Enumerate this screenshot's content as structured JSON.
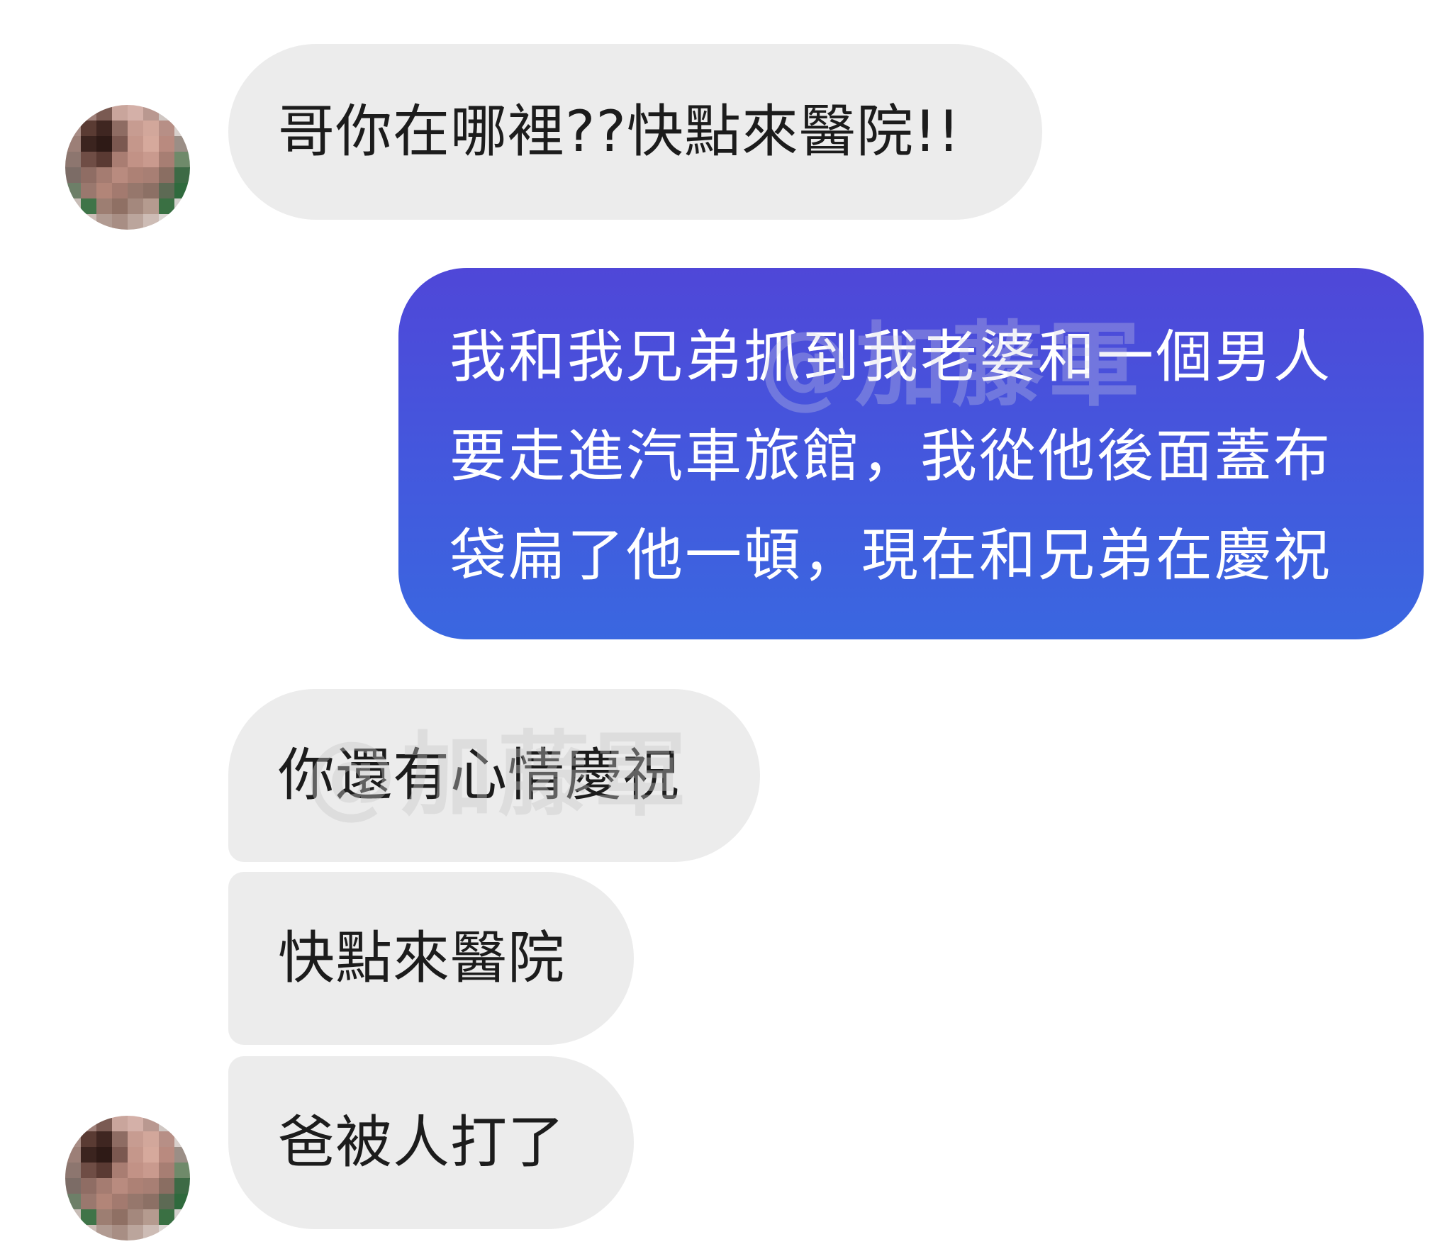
{
  "conversation": {
    "messages": [
      {
        "sender": "contact",
        "text": "哥你在哪裡??快點來醫院!!"
      },
      {
        "sender": "me",
        "text": "我和我兄弟抓到我老婆和一個男人要走進汽車旅館，我從他後面蓋布袋扁了他一頓，現在和兄弟在慶祝"
      },
      {
        "sender": "contact",
        "text": "你還有心情慶祝"
      },
      {
        "sender": "contact",
        "text": "快點來醫院"
      },
      {
        "sender": "contact",
        "text": "爸被人打了"
      }
    ]
  },
  "watermark": {
    "text": "@加藤軍"
  },
  "colors": {
    "incoming_bubble": "#ececec",
    "outgoing_bubble_top": "#4f47d8",
    "outgoing_bubble_bottom": "#3a67e0",
    "incoming_text": "#1c1c1c",
    "outgoing_text": "#ffffff"
  }
}
